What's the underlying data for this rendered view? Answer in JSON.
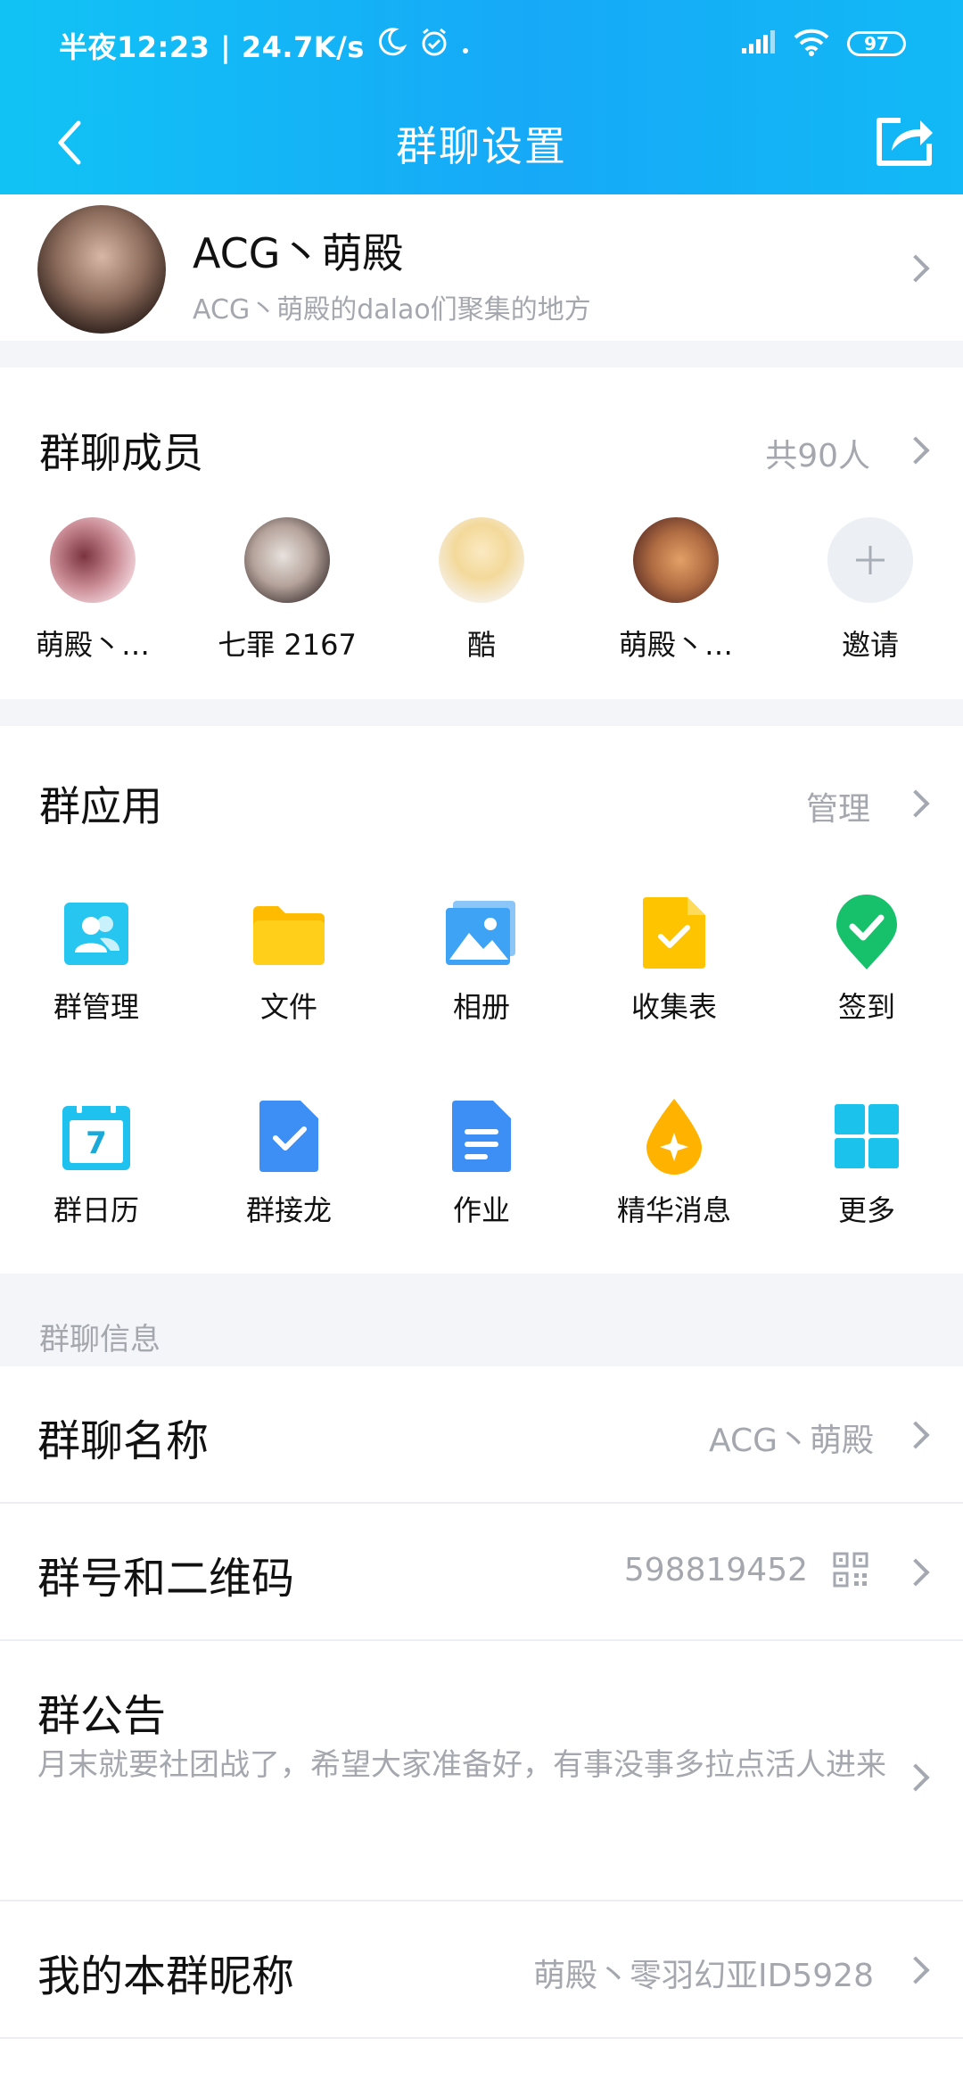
{
  "status_bar": {
    "time": "半夜12:23 | 24.7K/s",
    "battery": "97"
  },
  "nav": {
    "title": "群聊设置"
  },
  "group": {
    "name": "ACG丶萌殿",
    "description": "ACG丶萌殿的dalao们聚集的地方"
  },
  "members": {
    "title": "群聊成员",
    "count_label": "共90人",
    "items": [
      {
        "name": "萌殿丶…"
      },
      {
        "name": "七罪 2167"
      },
      {
        "name": "酷"
      },
      {
        "name": "萌殿丶…"
      },
      {
        "name": "邀请"
      }
    ]
  },
  "apps": {
    "title": "群应用",
    "manage_label": "管理",
    "items": [
      {
        "label": "群管理",
        "icon": "group-manage-icon"
      },
      {
        "label": "文件",
        "icon": "folder-icon"
      },
      {
        "label": "相册",
        "icon": "album-icon"
      },
      {
        "label": "收集表",
        "icon": "collect-form-icon"
      },
      {
        "label": "签到",
        "icon": "check-in-icon"
      },
      {
        "label": "群日历",
        "icon": "calendar-icon"
      },
      {
        "label": "群接龙",
        "icon": "relay-icon"
      },
      {
        "label": "作业",
        "icon": "homework-icon"
      },
      {
        "label": "精华消息",
        "icon": "essence-icon"
      },
      {
        "label": "更多",
        "icon": "more-grid-icon"
      }
    ],
    "calendar_day": "7"
  },
  "info": {
    "section_title": "群聊信息",
    "name_row": {
      "label": "群聊名称",
      "value": "ACG丶萌殿"
    },
    "number_row": {
      "label": "群号和二维码",
      "value": "598819452"
    },
    "notice_row": {
      "label": "群公告",
      "value": "月末就要社团战了，希望大家准备好，有事没事多拉点活人进来"
    },
    "nickname_row": {
      "label": "我的本群昵称",
      "value": "萌殿丶零羽幻亚ID5928"
    }
  }
}
